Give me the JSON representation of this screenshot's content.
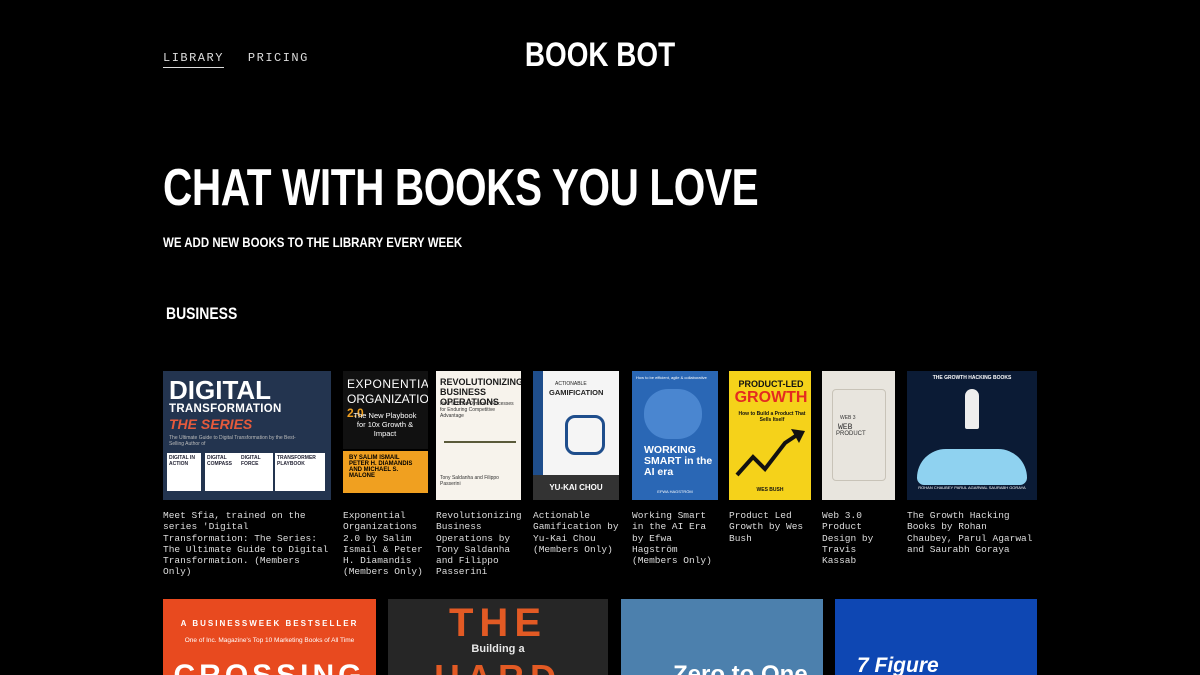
{
  "nav": {
    "library": "LIBRARY",
    "pricing": "PRICING"
  },
  "brand": "BOOK BOT",
  "hero": {
    "title": "CHAT WITH BOOKS YOU LOVE",
    "subtitle": "WE ADD NEW BOOKS TO THE LIBRARY EVERY WEEK"
  },
  "section": {
    "title": "BUSINESS"
  },
  "books": [
    {
      "caption": "Meet Sfia, trained on the series 'Digital Transformation: The Series: The Ultimate Guide to Digital Transformation. (Members Only)",
      "cover": {
        "line1": "DIGITAL",
        "line2": "TRANSFORMATION",
        "line3": "THE SERIES",
        "line4": "The Ultimate Guide to Digital Transformation by the Best-Selling Author of",
        "mini": [
          "DIGITAL IN ACTION",
          "DIGITAL COMPASS",
          "DIGITAL FORCE",
          "TRANSFORMER PLAYBOOK"
        ]
      }
    },
    {
      "caption": "Exponential Organizations 2.0 by Salim Ismail & Peter H. Diamandis (Members Only)",
      "cover": {
        "line1": "EXPONENTIAL",
        "line2a": "ORGANIZATIONS",
        "line2b": "2.0",
        "line3": "The New Playbook for 10x Growth & Impact",
        "line4": "BY SALIM ISMAIL PETER H. DIAMANDIS AND MICHAEL S. MALONE"
      }
    },
    {
      "caption": "Revolutionizing Business Operations by Tony Saldanha and Filippo Passerini",
      "cover": {
        "line1": "REVOLUTIONIZING BUSINESS OPERATIONS",
        "line2": "How to Build Dynamic Processes for Enduring Competitive Advantage",
        "line3": "Tony Saldanha and Filippo Passerini"
      }
    },
    {
      "caption": "Actionable Gamification by Yu-Kai Chou (Members Only)",
      "cover": {
        "line1": "ACTIONABLE",
        "line2": "GAMIFICATION",
        "author": "YU-KAI CHOU"
      }
    },
    {
      "caption": "Working Smart in the AI Era by Efwa Hagström (Members Only)",
      "cover": {
        "line0": "How to be efficient, agile & collaborative",
        "line1": "WORKING",
        "line2": "SMART in the AI era",
        "author": "EFWA HAGSTRÖM"
      }
    },
    {
      "caption": "Product Led Growth by Wes Bush",
      "cover": {
        "line1": "PRODUCT-LED",
        "line2": "GROWTH",
        "line3": "How to Build a Product That Sells Itself",
        "author": "WES BUSH"
      }
    },
    {
      "caption": "Web 3.0 Product Design by Travis Kassab",
      "cover": {
        "line1": "WEB 3",
        "line2": "WEB",
        "line3": "PRODUCT"
      }
    },
    {
      "caption": "The Growth Hacking Books by Rohan Chaubey, Parul Agarwal and Saurabh Goraya",
      "cover": {
        "line1": "THE GROWTH HACKING BOOKS",
        "line2": "ROHAN CHAUBEY PARUL AGARWAL SAURABH GORAYA"
      }
    }
  ],
  "books_row2": [
    {
      "line1": "A BUSINESSWEEK BESTSELLER",
      "line2": "One of Inc. Magazine's Top 10 Marketing Books of All Time",
      "line3": "CROSSING"
    },
    {
      "line1": "THE",
      "line2": "Building a",
      "line3": "HARD"
    },
    {
      "line1": "Zero to One"
    },
    {
      "line1": "7 Figure"
    }
  ]
}
